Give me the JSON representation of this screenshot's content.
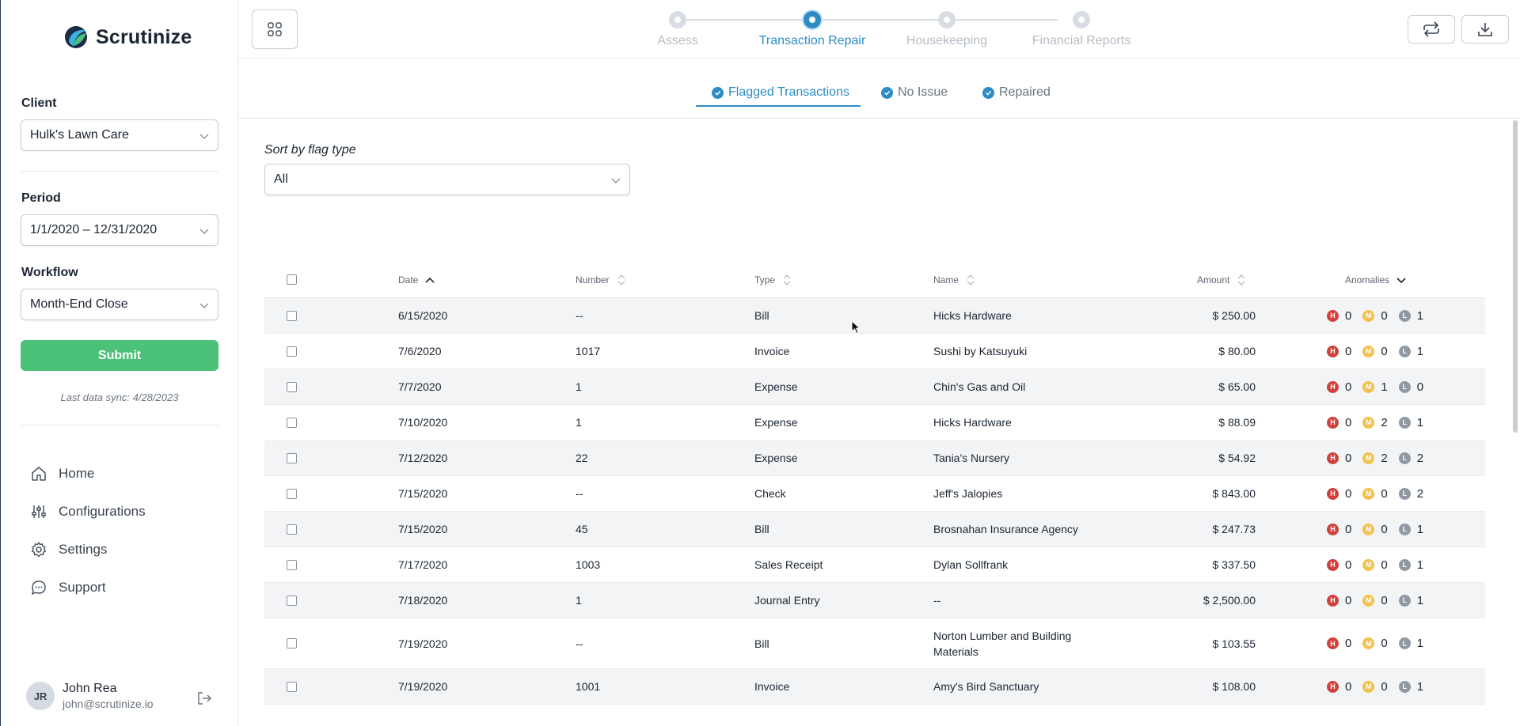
{
  "app": {
    "name": "Scrutinize",
    "accent": "#2d8cc4",
    "success": "#4cc17a"
  },
  "sidebar": {
    "client_label": "Client",
    "client_value": "Hulk's Lawn Care",
    "period_label": "Period",
    "period_value": "1/1/2020 – 12/31/2020",
    "workflow_label": "Workflow",
    "workflow_value": "Month-End Close",
    "submit_label": "Submit",
    "sync_text": "Last data sync: 4/28/2023",
    "nav": [
      {
        "label": "Home",
        "icon": "home-icon"
      },
      {
        "label": "Configurations",
        "icon": "sliders-icon"
      },
      {
        "label": "Settings",
        "icon": "gear-icon"
      },
      {
        "label": "Support",
        "icon": "chat-icon"
      }
    ],
    "user": {
      "initials": "JR",
      "name": "John Rea",
      "email": "john@scrutinize.io"
    }
  },
  "header": {
    "steps": [
      {
        "label": "Assess",
        "active": false
      },
      {
        "label": "Transaction Repair",
        "active": true
      },
      {
        "label": "Housekeeping",
        "active": false
      },
      {
        "label": "Financial Reports",
        "active": false
      }
    ]
  },
  "tabs": [
    {
      "label": "Flagged Transactions",
      "active": true
    },
    {
      "label": "No Issue",
      "active": false
    },
    {
      "label": "Repaired",
      "active": false
    }
  ],
  "filter": {
    "label": "Sort by flag type",
    "value": "All"
  },
  "table": {
    "columns": {
      "date": "Date",
      "number": "Number",
      "type": "Type",
      "name": "Name",
      "amount": "Amount",
      "anomalies": "Anomalies"
    },
    "rows": [
      {
        "date": "6/15/2020",
        "number": "--",
        "type": "Bill",
        "name": "Hicks Hardware",
        "amount": "$ 250.00",
        "h": "0",
        "m": "0",
        "l": "1"
      },
      {
        "date": "7/6/2020",
        "number": "1017",
        "type": "Invoice",
        "name": "Sushi by Katsuyuki",
        "amount": "$ 80.00",
        "h": "0",
        "m": "0",
        "l": "1"
      },
      {
        "date": "7/7/2020",
        "number": "1",
        "type": "Expense",
        "name": "Chin's Gas and Oil",
        "amount": "$ 65.00",
        "h": "0",
        "m": "1",
        "l": "0"
      },
      {
        "date": "7/10/2020",
        "number": "1",
        "type": "Expense",
        "name": "Hicks Hardware",
        "amount": "$ 88.09",
        "h": "0",
        "m": "2",
        "l": "1"
      },
      {
        "date": "7/12/2020",
        "number": "22",
        "type": "Expense",
        "name": "Tania's Nursery",
        "amount": "$ 54.92",
        "h": "0",
        "m": "2",
        "l": "2"
      },
      {
        "date": "7/15/2020",
        "number": "--",
        "type": "Check",
        "name": "Jeff's Jalopies",
        "amount": "$ 843.00",
        "h": "0",
        "m": "0",
        "l": "2"
      },
      {
        "date": "7/15/2020",
        "number": "45",
        "type": "Bill",
        "name": "Brosnahan Insurance Agency",
        "amount": "$ 247.73",
        "h": "0",
        "m": "0",
        "l": "1"
      },
      {
        "date": "7/17/2020",
        "number": "1003",
        "type": "Sales Receipt",
        "name": "Dylan Sollfrank",
        "amount": "$ 337.50",
        "h": "0",
        "m": "0",
        "l": "1"
      },
      {
        "date": "7/18/2020",
        "number": "1",
        "type": "Journal Entry",
        "name": "--",
        "amount": "$ 2,500.00",
        "h": "0",
        "m": "0",
        "l": "1"
      },
      {
        "date": "7/19/2020",
        "number": "--",
        "type": "Bill",
        "name": "Norton Lumber and Building Materials",
        "amount": "$ 103.55",
        "h": "0",
        "m": "0",
        "l": "1"
      },
      {
        "date": "7/19/2020",
        "number": "1001",
        "type": "Invoice",
        "name": "Amy's Bird Sanctuary",
        "amount": "$ 108.00",
        "h": "0",
        "m": "0",
        "l": "1"
      }
    ]
  }
}
